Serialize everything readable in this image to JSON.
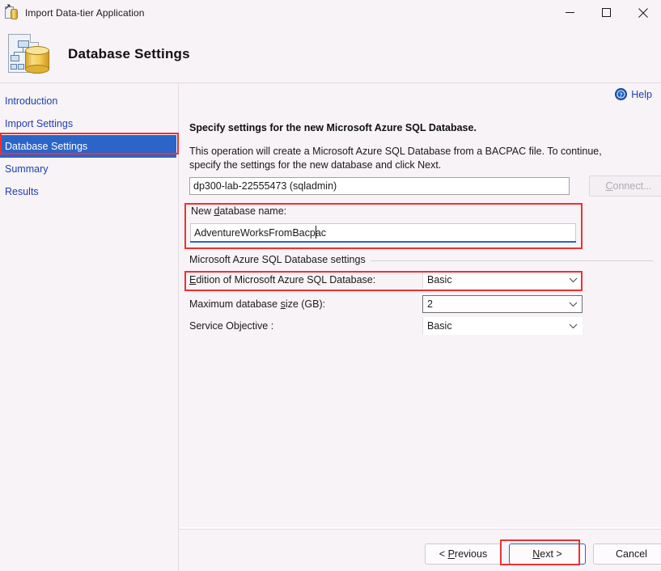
{
  "window": {
    "title": "Import Data-tier Application",
    "icon": "data-tier-application-icon",
    "controls": {
      "minimize": "minimize-icon",
      "maximize": "maximize-icon",
      "close": "close-icon"
    }
  },
  "header": {
    "title": "Database Settings",
    "icon": "database-document-icon"
  },
  "sidebar": {
    "items": [
      {
        "label": "Introduction",
        "selected": false
      },
      {
        "label": "Import Settings",
        "selected": false
      },
      {
        "label": "Database Settings",
        "selected": true
      },
      {
        "label": "Summary",
        "selected": false
      },
      {
        "label": "Results",
        "selected": false
      }
    ]
  },
  "help": {
    "label": "Help",
    "icon": "help-circle-icon"
  },
  "main": {
    "lead_title": "Specify settings for the new Microsoft Azure SQL Database.",
    "lead_description": "This operation will create a Microsoft Azure SQL Database from a BACPAC file. To continue, specify the settings for the new database and click Next.",
    "server": {
      "value": "dp300-lab-22555473 (sqladmin)",
      "connect_button": "Connect...",
      "connect_accel": "C",
      "connect_enabled": false
    },
    "new_database": {
      "label_before": "New ",
      "label_accel": "d",
      "label_after": "atabase name:",
      "value": "AdventureWorksFromBacpac",
      "focused": true
    },
    "group": {
      "title": "Microsoft Azure SQL Database settings",
      "fields": [
        {
          "label_before": "",
          "label_accel": "E",
          "label_after": "dition of Microsoft Azure SQL Database:",
          "value": "Basic",
          "bordered": false,
          "name": "edition"
        },
        {
          "label_before": "Maximum database ",
          "label_accel": "s",
          "label_after": "ize (GB):",
          "value": "2",
          "bordered": true,
          "name": "max-size"
        },
        {
          "label_before": "Service Objective :",
          "label_accel": "",
          "label_after": "",
          "value": "Basic",
          "bordered": false,
          "name": "service-objective"
        }
      ]
    }
  },
  "footer": {
    "previous": {
      "before": "< ",
      "accel": "P",
      "after": "revious"
    },
    "next": {
      "before": "",
      "accel": "N",
      "after": "ext >",
      "default": true
    },
    "cancel": {
      "before": "Cancel",
      "accel": "",
      "after": ""
    }
  },
  "annotations": {
    "color": "#f03030",
    "targets": [
      "sidebar-item-database-settings",
      "new-database-name-block",
      "edition-dropdown",
      "next-button"
    ]
  },
  "colors": {
    "background": "#f7f3f7",
    "selection": "#2b65c8",
    "link": "#1f3fb0",
    "annotation": "#f03030",
    "field_border": "#a2a2a2"
  }
}
